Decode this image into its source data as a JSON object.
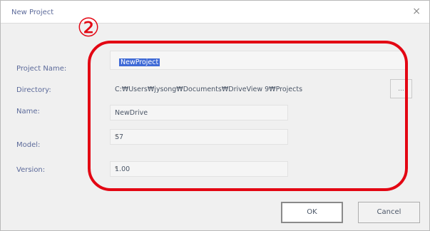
{
  "window": {
    "title": "New Project",
    "close_glyph": "×"
  },
  "annotation": {
    "marker": "②",
    "highlight_color": "#e30613"
  },
  "form": {
    "project_name_label": "Project Name:",
    "project_name_value": "NewProject",
    "directory_label": "Directory:",
    "directory_value": "C:₩Users₩jysong₩Documents₩DriveView 9₩Projects",
    "browse_label": "...",
    "name_label": "Name:",
    "name_value": "NewDrive",
    "model_label": "Model:",
    "model_value": "S7",
    "version_label": "Version:",
    "version_value": "1.00"
  },
  "buttons": {
    "ok_label": "OK",
    "cancel_label": "Cancel"
  },
  "colors": {
    "selection": "#3f6ad6",
    "label_text": "#5c6a9a"
  }
}
